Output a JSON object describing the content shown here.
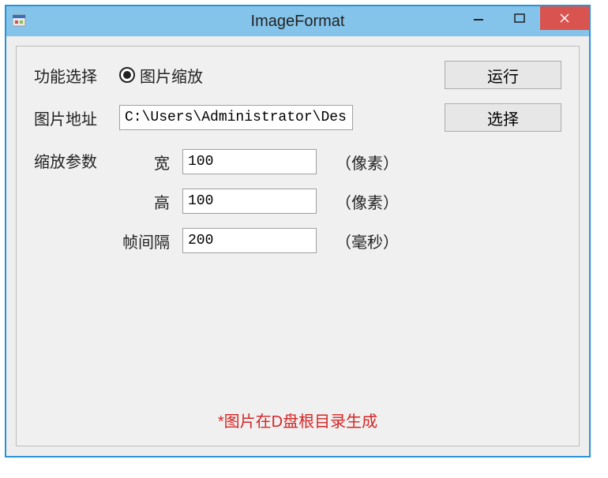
{
  "window": {
    "title": "ImageFormat"
  },
  "labels": {
    "function_select": "功能选择",
    "radio_image_scale": "图片缩放",
    "image_path": "图片地址",
    "scale_params": "缩放参数",
    "width": "宽",
    "height": "高",
    "frame_interval": "帧间隔",
    "unit_px": "（像素）",
    "unit_ms": "（毫秒）"
  },
  "buttons": {
    "run": "运行",
    "select": "选择"
  },
  "inputs": {
    "path_value": "C:\\Users\\Administrator\\Desktop\\fa",
    "width_value": "100",
    "height_value": "100",
    "interval_value": "200"
  },
  "footer": {
    "note": "*图片在D盘根目录生成"
  }
}
